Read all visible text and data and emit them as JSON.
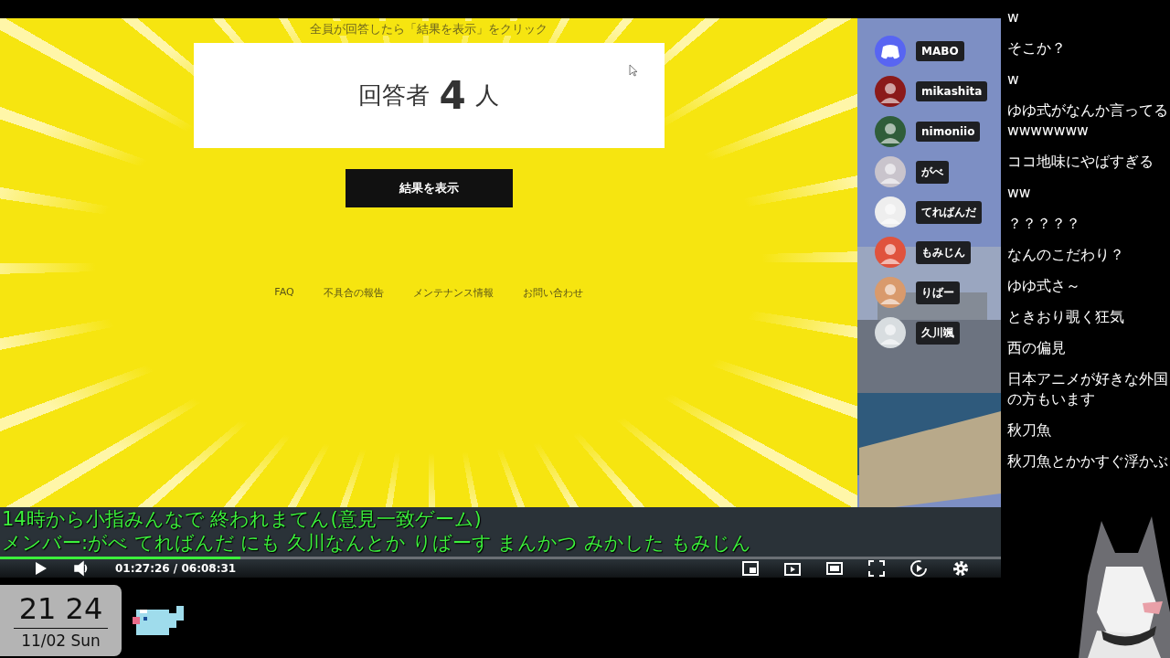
{
  "page": {
    "instruction": "全員が回答したら「結果を表示」をクリック",
    "respondents": {
      "prefix": "回答者",
      "count": "4",
      "suffix": "人"
    },
    "result_button": "結果を表示",
    "footer_links": [
      "FAQ",
      "不具合の報告",
      "メンテナンス情報",
      "お問い合わせ"
    ]
  },
  "voice_members": [
    {
      "name": "MABO",
      "kind": "discord",
      "color": "#5865f2"
    },
    {
      "name": "mikashita",
      "kind": "avatar",
      "color": "#8b1a1a"
    },
    {
      "name": "nimoniio",
      "kind": "avatar",
      "color": "#2f5d3a"
    },
    {
      "name": "がべ",
      "kind": "avatar",
      "color": "#c9c4cc"
    },
    {
      "name": "てればんだ",
      "kind": "avatar",
      "color": "#eeeeee"
    },
    {
      "name": "もみじん",
      "kind": "avatar",
      "color": "#e0533d"
    },
    {
      "name": "りばー",
      "kind": "avatar",
      "color": "#d99a6c"
    },
    {
      "name": "久川颯",
      "kind": "avatar",
      "color": "#d8dde0"
    }
  ],
  "subtitles": [
    "14時から小指みんなで 終われまてん(意見一致ゲーム)",
    "メンバー:がべ てればんだ にも 久川なんとか りばーす まんかつ みかした もみじん"
  ],
  "player": {
    "progress": {
      "level": 0.24
    },
    "time": "01:27:26 / 06:08:31"
  },
  "chat": [
    "w",
    "そこか？",
    "w",
    "ゆゆ式がなんか言ってるwwwwwww",
    "ココ地味にやばすぎる",
    "ww",
    "？？？？？",
    "なんのこだわり？",
    "ゆゆ式さ～",
    "ときおり覗く狂気",
    "西の偏見",
    "日本アニメが好きな外国の方もいます",
    "秋刀魚",
    "秋刀魚とかかすぐ浮かぶ"
  ],
  "clock": {
    "time": "21 24",
    "date": "11/02 Sun"
  }
}
